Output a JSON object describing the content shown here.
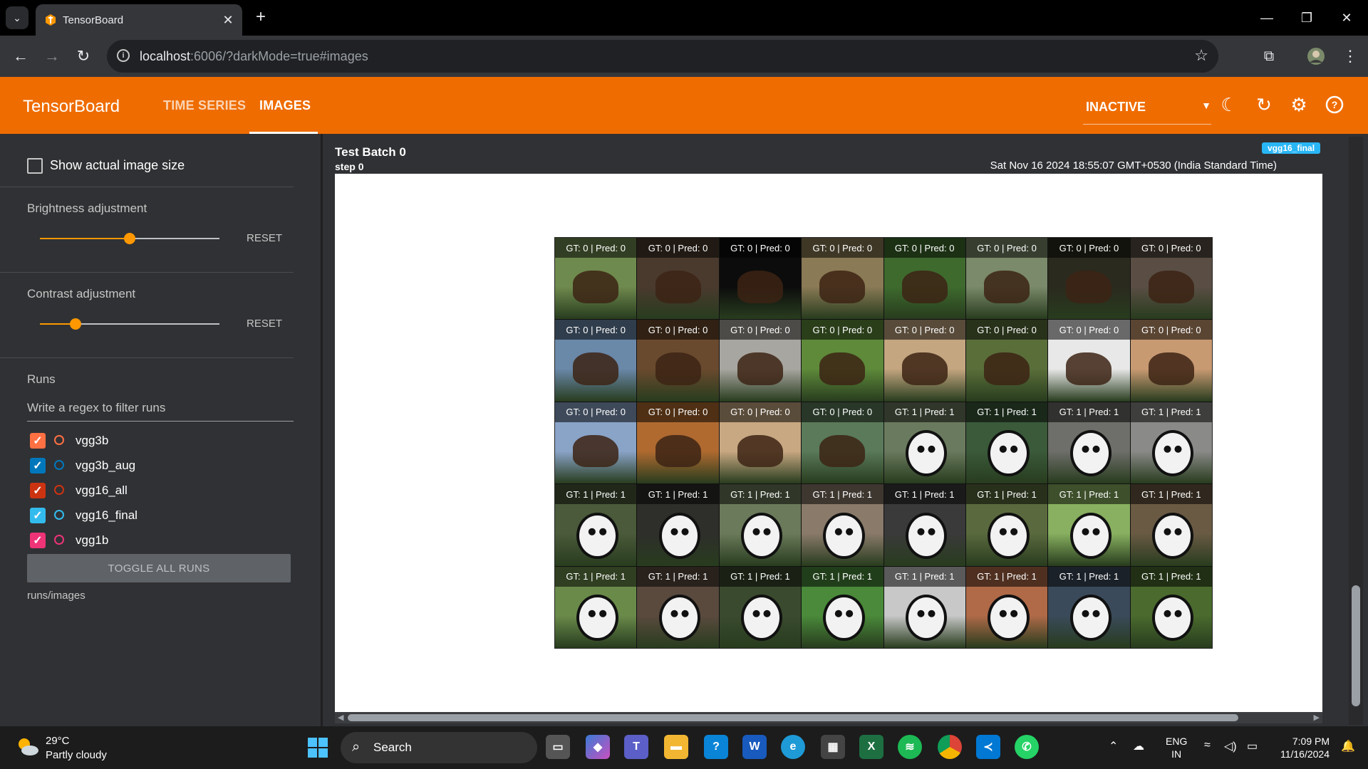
{
  "browser": {
    "tab_title": "TensorBoard",
    "url_host": "localhost",
    "url_rest": ":6006/?darkMode=true#images"
  },
  "tensorboard": {
    "logo": "TensorBoard",
    "tabs": [
      {
        "label": "TIME SERIES",
        "active": false
      },
      {
        "label": "IMAGES",
        "active": true
      }
    ],
    "run_status": "INACTIVE",
    "accent_color": "#ef6c00"
  },
  "sidebar": {
    "show_actual_size_label": "Show actual image size",
    "brightness": {
      "title": "Brightness adjustment",
      "value": 0.5,
      "reset_label": "RESET"
    },
    "contrast": {
      "title": "Contrast adjustment",
      "value": 0.2,
      "reset_label": "RESET"
    },
    "runs_title": "Runs",
    "filter_placeholder": "Write a regex to filter runs",
    "runs": [
      {
        "name": "vgg3b",
        "color": "#ff7043",
        "checked": true
      },
      {
        "name": "vgg3b_aug",
        "color": "#0077bb",
        "checked": true
      },
      {
        "name": "vgg16_all",
        "color": "#cc3311",
        "checked": true
      },
      {
        "name": "vgg16_final",
        "color": "#33bbee",
        "checked": true
      },
      {
        "name": "vgg1b",
        "color": "#ee3377",
        "checked": true
      }
    ],
    "toggle_all_label": "TOGGLE ALL RUNS",
    "tag_path": "runs/images"
  },
  "card": {
    "title": "Test Batch 0",
    "step_label": "step",
    "step_value": "0",
    "run_chip": "vgg16_final",
    "timestamp": "Sat Nov 16 2024 18:55:07 GMT+0530 (India Standard Time)",
    "captions": [
      [
        "GT: 0 | Pred: 0",
        "GT: 0 | Pred: 0",
        "GT: 0 | Pred: 0",
        "GT: 0 | Pred: 0",
        "GT: 0 | Pred: 0",
        "GT: 0 | Pred: 0",
        "GT: 0 | Pred: 0",
        "GT: 0 | Pred: 0"
      ],
      [
        "GT: 0 | Pred: 0",
        "GT: 0 | Pred: 0",
        "GT: 0 | Pred: 0",
        "GT: 0 | Pred: 0",
        "GT: 0 | Pred: 0",
        "GT: 0 | Pred: 0",
        "GT: 0 | Pred: 0",
        "GT: 0 | Pred: 0"
      ],
      [
        "GT: 0 | Pred: 0",
        "GT: 0 | Pred: 0",
        "GT: 0 | Pred: 0",
        "GT: 0 | Pred: 0",
        "GT: 1 | Pred: 1",
        "GT: 1 | Pred: 1",
        "GT: 1 | Pred: 1",
        "GT: 1 | Pred: 1"
      ],
      [
        "GT: 1 | Pred: 1",
        "GT: 1 | Pred: 1",
        "GT: 1 | Pred: 1",
        "GT: 1 | Pred: 1",
        "GT: 1 | Pred: 1",
        "GT: 1 | Pred: 1",
        "GT: 1 | Pred: 1",
        "GT: 1 | Pred: 1"
      ],
      [
        "GT: 1 | Pred: 1",
        "GT: 1 | Pred: 1",
        "GT: 1 | Pred: 1",
        "GT: 1 | Pred: 1",
        "GT: 1 | Pred: 1",
        "GT: 1 | Pred: 1",
        "GT: 1 | Pred: 1",
        "GT: 1 | Pred: 1"
      ]
    ],
    "cell_colors": [
      [
        "#6f8a4e",
        "#4a3a2e",
        "#0c0c0c",
        "#8a7a55",
        "#3e6a2e",
        "#7a8a6a",
        "#2a2a1e",
        "#5a4e44"
      ],
      [
        "#6a88a8",
        "#6a4a2e",
        "#a8a6a0",
        "#5e8a3a",
        "#c4a680",
        "#5a6e3a",
        "#e8e8e8",
        "#c89a72"
      ],
      [
        "#8aa4c8",
        "#b06a30",
        "#c8a882",
        "#5a7a5a",
        "#6a7a5e",
        "#3a5a3a",
        "#6e6e6a",
        "#8a8a88"
      ],
      [
        "#4a5a3a",
        "#2e2e2a",
        "#6a7a5a",
        "#8a7a6a",
        "#3a3a3a",
        "#5a6a3e",
        "#88b060",
        "#6a5a44"
      ],
      [
        "#6a8a4a",
        "#5a4a3e",
        "#3a4a2e",
        "#4a8a3a",
        "#c8c8c8",
        "#b06a48",
        "#3a4a5a",
        "#4a6a2e"
      ]
    ]
  },
  "taskbar": {
    "temp": "29°C",
    "weather": "Partly cloudy",
    "search_label": "Search",
    "lang_line1": "ENG",
    "lang_line2": "IN",
    "time": "7:09 PM",
    "date": "11/16/2024"
  }
}
